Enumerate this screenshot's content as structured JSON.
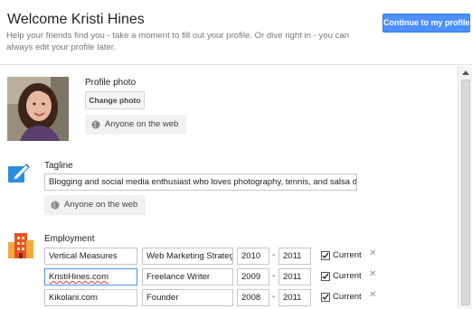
{
  "header": {
    "title": "Welcome Kristi Hines",
    "subtitle": "Help your friends find you - take a moment to fill out your profile. Or dive right in - you can always edit your profile later.",
    "continue_label": "Continue to my profile",
    "accent_color": "#4d90fe"
  },
  "profile_photo": {
    "label": "Profile photo",
    "change_label": "Change photo",
    "visibility": "Anyone on the web"
  },
  "tagline": {
    "label": "Tagline",
    "value": "Blogging and social media enthusiast who loves photography, tennis, and salsa d",
    "visibility": "Anyone on the web"
  },
  "employment": {
    "label": "Employment",
    "current_label": "Current",
    "remove_icon": "close-icon",
    "rows": [
      {
        "company": "Vertical Measures",
        "title": "Web Marketing Strateg",
        "start": "2010",
        "end": "2011",
        "current": true
      },
      {
        "company": "KristiHines.com",
        "title": "Freelance Writer",
        "start": "2009",
        "end": "2011",
        "current": true
      },
      {
        "company": "Kikolani.com",
        "title": "Founder",
        "start": "2008",
        "end": "2011",
        "current": true
      }
    ],
    "dash": "-"
  }
}
